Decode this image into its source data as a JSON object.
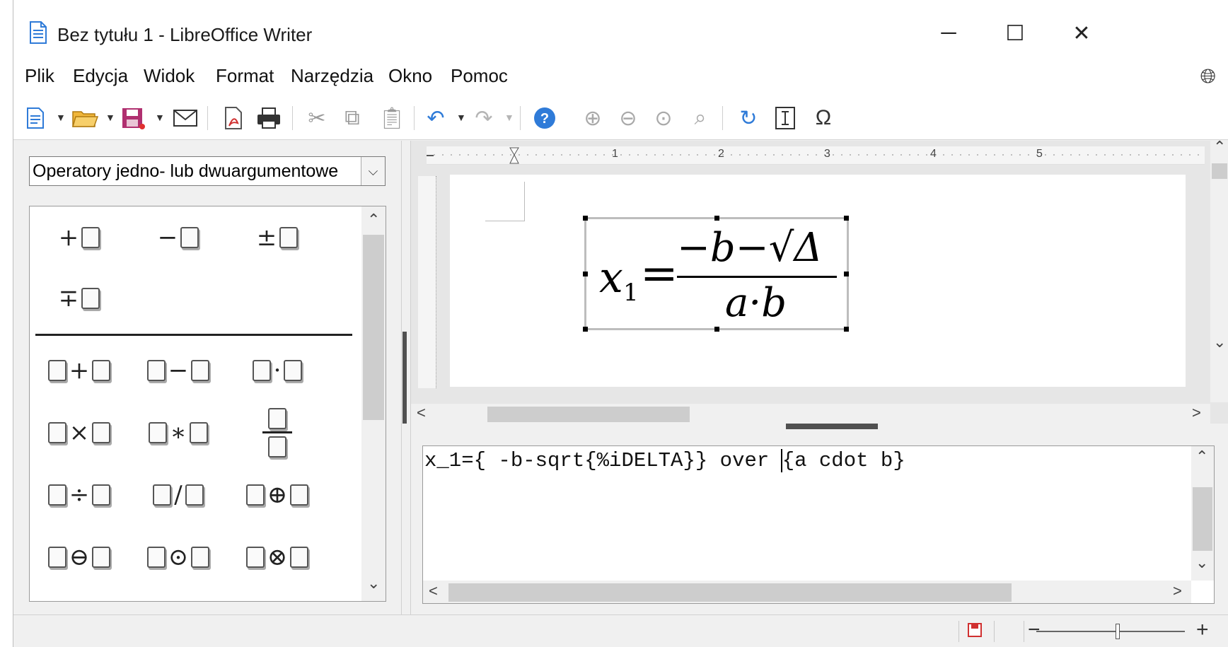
{
  "window": {
    "title": "Bez tytułu 1 - LibreOffice Writer",
    "controls": {
      "minimize": "─",
      "maximize": "☐",
      "close": "✕"
    }
  },
  "menu": {
    "items": [
      {
        "label": "Plik"
      },
      {
        "label": "Edycja"
      },
      {
        "label": "Widok"
      },
      {
        "label": "Format"
      },
      {
        "label": "Narzędzia"
      },
      {
        "label": "Okno"
      },
      {
        "label": "Pomoc"
      }
    ]
  },
  "toolbar": {
    "icons": [
      "new-document-icon",
      "open-folder-icon",
      "save-icon",
      "mail-icon",
      "export-pdf-icon",
      "print-icon",
      "cut-icon",
      "copy-icon",
      "paste-icon",
      "undo-icon",
      "redo-icon",
      "help-icon",
      "zoom-in-icon",
      "zoom-out-icon",
      "zoom-100-icon",
      "zoom-fit-icon",
      "update-icon",
      "formula-cursor-icon",
      "symbols-icon"
    ]
  },
  "elements_panel": {
    "category": "Operatory jedno- lub dwuargumentowe",
    "unary": [
      "+",
      "−",
      "±",
      "∓"
    ],
    "binary": [
      "+",
      "−",
      "·",
      "×",
      "∗",
      "÷",
      "/",
      "⊕",
      "⊖",
      "⊙",
      "⊗"
    ]
  },
  "ruler": {
    "marks": [
      "1",
      "2",
      "3",
      "4",
      "5"
    ]
  },
  "formula": {
    "lhs_var": "x",
    "lhs_sub": "1",
    "equals": "=",
    "numerator": "−b−√Δ",
    "denominator": "a·b"
  },
  "command": {
    "text_before_cursor": "x_1={ -b-sqrt{%iDELTA}} over ",
    "text_after_cursor": "{a cdot b}"
  },
  "status": {
    "zoom_minus": "−",
    "zoom_plus": "+"
  },
  "colors": {
    "accent": "#2f7bd8",
    "folder": "#f0b63a",
    "save": "#b03070",
    "pdf": "#d03030"
  }
}
